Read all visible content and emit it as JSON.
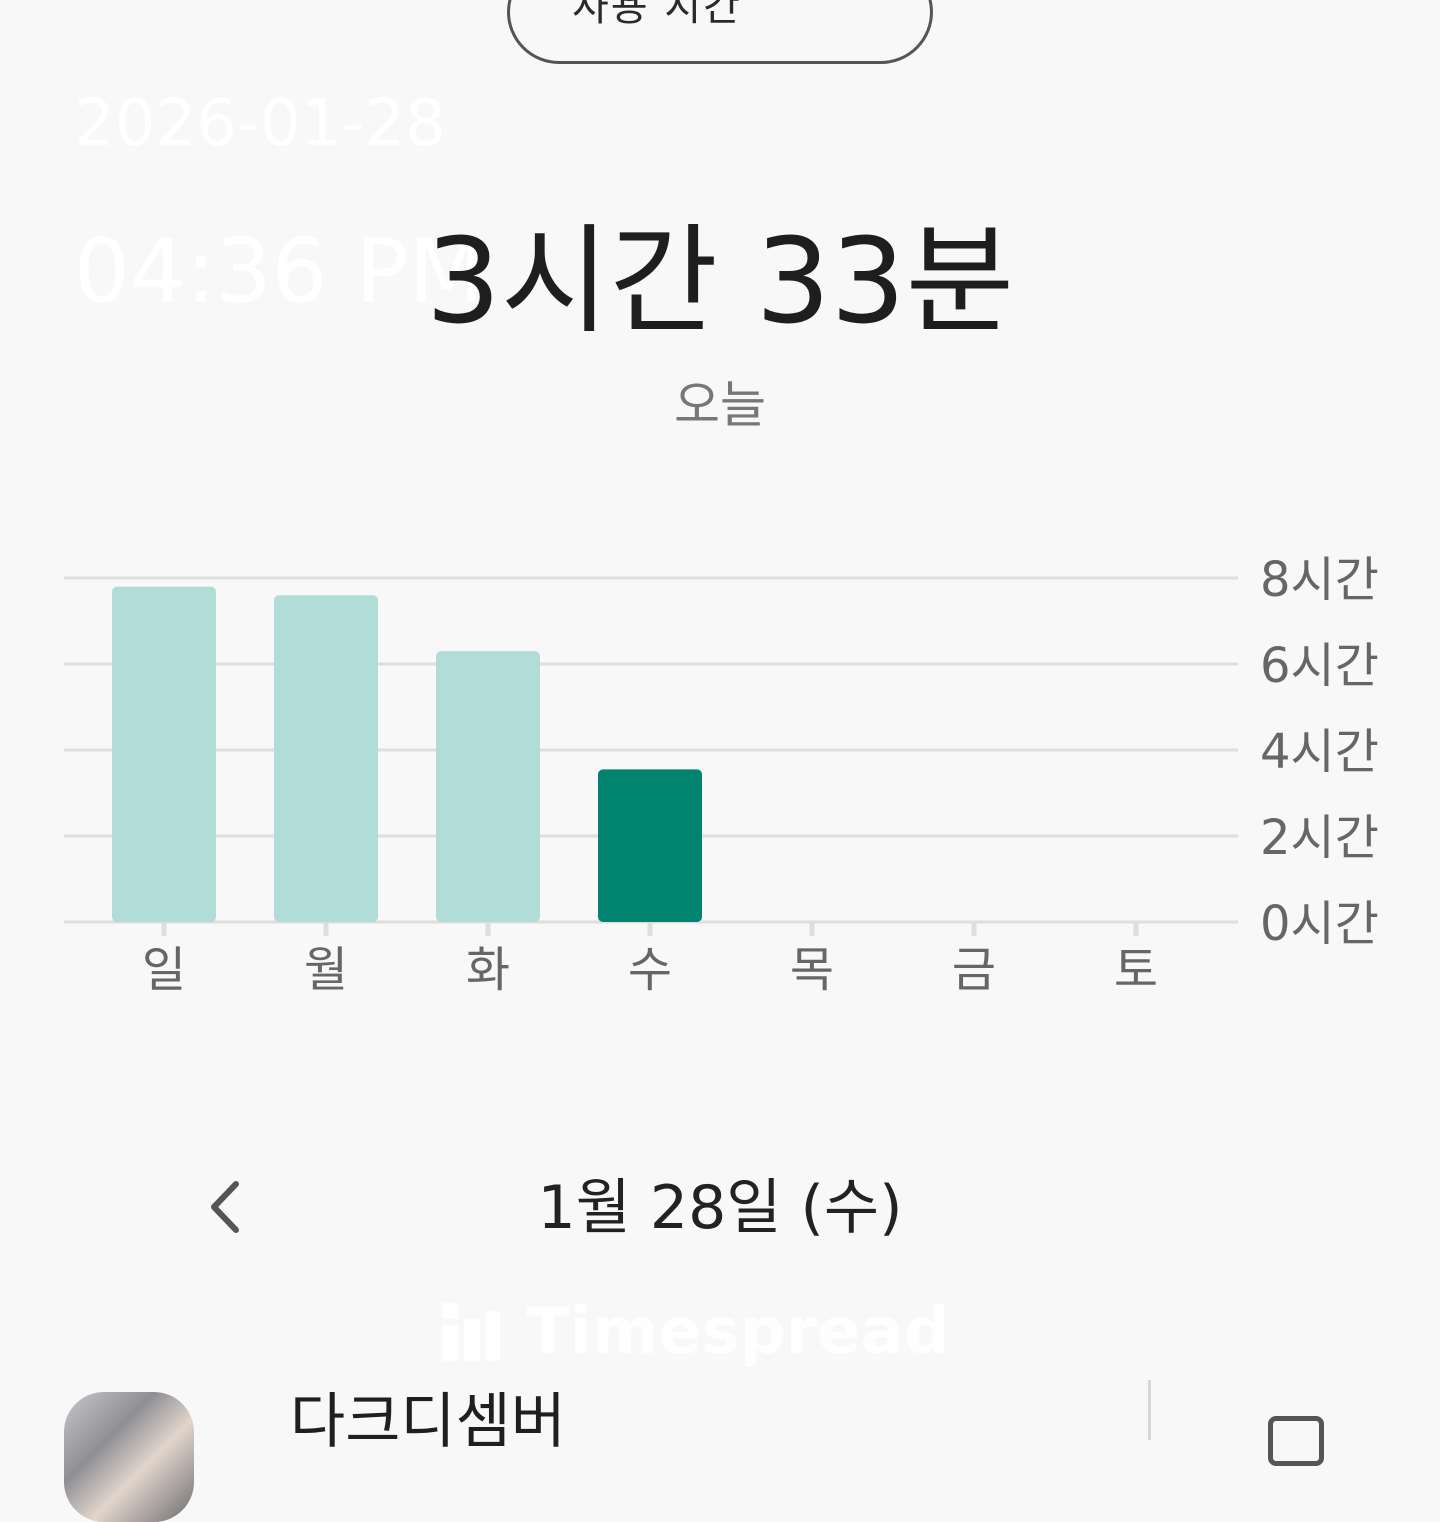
{
  "header": {
    "dropdown_label": "사용 시간",
    "dropdown_icon": "caret-down-icon"
  },
  "overlay": {
    "date": "2026-01-28",
    "time": "04:36 PM"
  },
  "summary": {
    "total_time": "3시간 33분",
    "period": "오늘"
  },
  "chart_data": {
    "type": "bar",
    "categories": [
      "일",
      "월",
      "화",
      "수",
      "목",
      "금",
      "토"
    ],
    "values": [
      7.8,
      7.6,
      6.3,
      3.55,
      0,
      0,
      0
    ],
    "ylim": [
      0,
      8
    ],
    "yticks": [
      0,
      2,
      4,
      6,
      8
    ],
    "ytick_labels": [
      "0시간",
      "2시간",
      "4시간",
      "6시간",
      "8시간"
    ],
    "highlight_index": 3,
    "colors": {
      "bar": "#b2dcd8",
      "highlight": "#00846f",
      "grid": "#dedede",
      "tick_label": "#666666"
    },
    "grid": true,
    "y_axis_side": "right"
  },
  "date_nav": {
    "prev_icon": "chevron-left-icon",
    "date_label": "1월 28일 (수)"
  },
  "watermark": {
    "text": "Timespread"
  },
  "app_list": [
    {
      "name": "다크디셈버",
      "icon": "app-icon",
      "action_icon": "timer-icon"
    }
  ]
}
